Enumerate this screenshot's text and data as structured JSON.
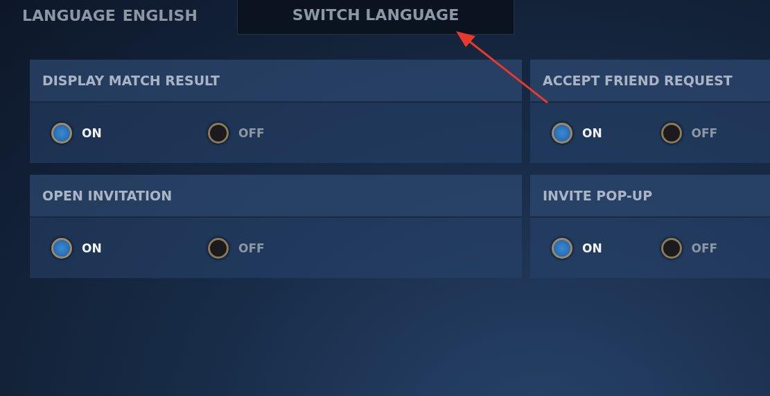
{
  "top_bar": {
    "language_label": "LANGUAGE",
    "language_value": "ENGLISH",
    "switch_button": "SWITCH LANGUAGE"
  },
  "settings": [
    {
      "title": "DISPLAY MATCH RESULT",
      "options": [
        {
          "label": "ON",
          "selected": true
        },
        {
          "label": "OFF",
          "selected": false
        }
      ]
    },
    {
      "title": "ACCEPT FRIEND REQUEST",
      "options": [
        {
          "label": "ON",
          "selected": true
        },
        {
          "label": "OFF",
          "selected": false
        }
      ]
    },
    {
      "title": "OPEN INVITATION",
      "options": [
        {
          "label": "ON",
          "selected": true
        },
        {
          "label": "OFF",
          "selected": false
        }
      ]
    },
    {
      "title": "INVITE POP-UP",
      "options": [
        {
          "label": "ON",
          "selected": true
        },
        {
          "label": "OFF",
          "selected": false
        }
      ]
    }
  ]
}
